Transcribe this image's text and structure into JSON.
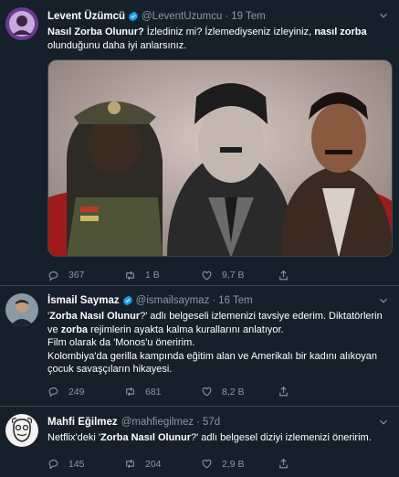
{
  "colors": {
    "background": "#15202b",
    "border": "#38444d",
    "muted": "#8899a6",
    "verified": "#1da1f2"
  },
  "tweets": [
    {
      "name": "Levent Üzümcü",
      "handle": "@LeventUzumcu",
      "time": "19 Tem",
      "verified": true,
      "text": {
        "p1": "Nasıl Zorba Olunur?",
        "p2": " İzlediniz mi? İzlemediyseniz izleyiniz, ",
        "p3": "nasıl zorba",
        "p4": " olunduğunu daha iyi anlarsınız."
      },
      "has_media": true,
      "replies": "367",
      "retweets": "1 B",
      "likes": "9,7 B"
    },
    {
      "name": "İsmail Saymaz",
      "handle": "@ismailsaymaz",
      "time": "16 Tem",
      "verified": true,
      "text": {
        "p1": "'",
        "p2": "Zorba Nasıl Olunur",
        "p3": "?' adlı belgeseli izlemenizi tavsiye ederim. Diktatörlerin ve ",
        "p4": "zorba",
        "p5": " rejimlerin ayakta kalma kurallarını anlatıyor.\nFilm olarak da 'Monos'u öneririm.\nKolombiya'da gerilla kampında eğitim alan ve Amerikalı bir kadını alıkoyan çocuk savaşçıların hikayesi."
      },
      "replies": "249",
      "retweets": "681",
      "likes": "8,2 B"
    },
    {
      "name": "Mahfi Eğilmez",
      "handle": "@mahfiegilmez",
      "time": "57d",
      "verified": false,
      "text": {
        "p1": "Netflix'deki '",
        "p2": "Zorba Nasıl Olunur",
        "p3": "?' adlı belgesel diziyi izlemenizi öneririm."
      },
      "replies": "145",
      "retweets": "204",
      "likes": "2,9 B"
    }
  ]
}
